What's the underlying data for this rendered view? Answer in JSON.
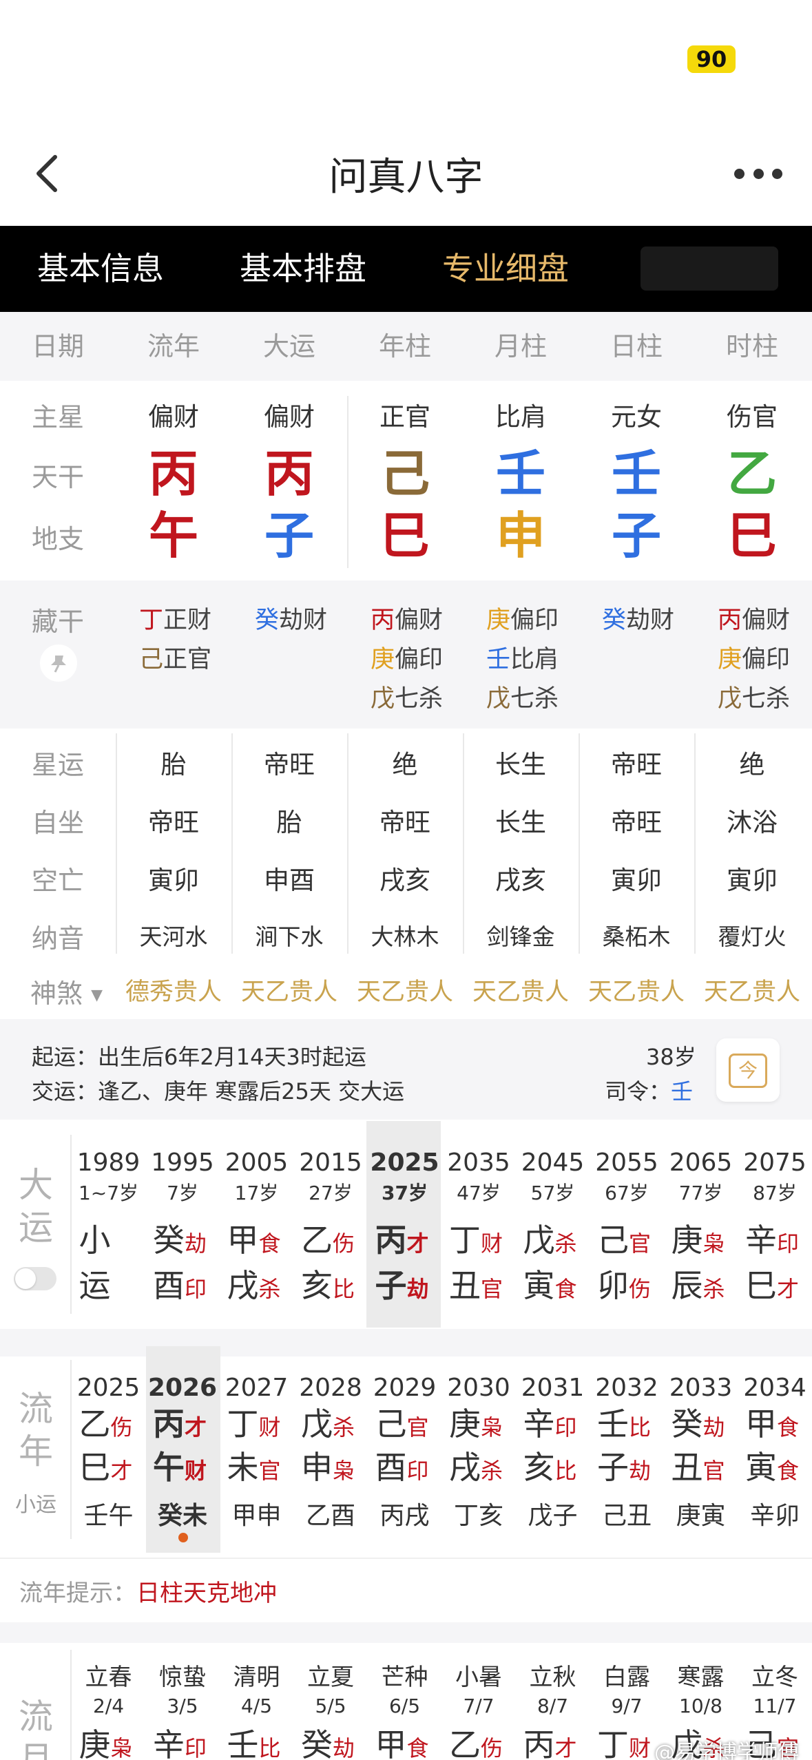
{
  "status": {
    "battery": "90"
  },
  "header": {
    "title": "问真八字"
  },
  "tabs": [
    "基本信息",
    "基本排盘",
    "专业细盘"
  ],
  "columns": [
    "日期",
    "流年",
    "大运",
    "年柱",
    "月柱",
    "日柱",
    "时柱"
  ],
  "zhuxing": {
    "label": "主星",
    "values": [
      "偏财",
      "偏财",
      "正官",
      "比肩",
      "元女",
      "伤官"
    ]
  },
  "tiangan": {
    "label": "天干",
    "values": [
      "丙",
      "丙",
      "己",
      "壬",
      "壬",
      "乙"
    ],
    "colors": [
      "#c0161e",
      "#c0161e",
      "#8a6a38",
      "#2f6fe0",
      "#2f6fe0",
      "#43a841"
    ]
  },
  "dizhi": {
    "label": "地支",
    "values": [
      "午",
      "子",
      "巳",
      "申",
      "子",
      "巳"
    ],
    "colors": [
      "#c0161e",
      "#2f6fe0",
      "#c0161e",
      "#e0a020",
      "#2f6fe0",
      "#c0161e"
    ]
  },
  "canggan": {
    "label": "藏干",
    "columns": [
      [
        {
          "g": "丁",
          "s": "正财",
          "c": "#c0161e"
        },
        {
          "g": "己",
          "s": "正官",
          "c": "#8a6a38"
        }
      ],
      [
        {
          "g": "癸",
          "s": "劫财",
          "c": "#2f6fe0"
        }
      ],
      [
        {
          "g": "丙",
          "s": "偏财",
          "c": "#c0161e"
        },
        {
          "g": "庚",
          "s": "偏印",
          "c": "#e0a020"
        },
        {
          "g": "戊",
          "s": "七杀",
          "c": "#8a6a38"
        }
      ],
      [
        {
          "g": "庚",
          "s": "偏印",
          "c": "#e0a020"
        },
        {
          "g": "壬",
          "s": "比肩",
          "c": "#2f6fe0"
        },
        {
          "g": "戊",
          "s": "七杀",
          "c": "#8a6a38"
        }
      ],
      [
        {
          "g": "癸",
          "s": "劫财",
          "c": "#2f6fe0"
        }
      ],
      [
        {
          "g": "丙",
          "s": "偏财",
          "c": "#c0161e"
        },
        {
          "g": "庚",
          "s": "偏印",
          "c": "#e0a020"
        },
        {
          "g": "戊",
          "s": "七杀",
          "c": "#8a6a38"
        }
      ]
    ]
  },
  "xingyun": {
    "label": "星运",
    "values": [
      "胎",
      "帝旺",
      "绝",
      "长生",
      "帝旺",
      "绝"
    ]
  },
  "zizuo": {
    "label": "自坐",
    "values": [
      "帝旺",
      "胎",
      "帝旺",
      "长生",
      "帝旺",
      "沐浴"
    ]
  },
  "kongwang": {
    "label": "空亡",
    "values": [
      "寅卯",
      "申酉",
      "戌亥",
      "戌亥",
      "寅卯",
      "寅卯"
    ]
  },
  "nayin": {
    "label": "纳音",
    "values": [
      "天河水",
      "涧下水",
      "大林木",
      "剑锋金",
      "桑柘木",
      "覆灯火"
    ]
  },
  "shensha": {
    "label": "神煞",
    "values": [
      "德秀贵人",
      "天乙贵人",
      "天乙贵人",
      "天乙贵人",
      "天乙贵人",
      "天乙贵人"
    ]
  },
  "qiyun": {
    "line1_label": "起运：",
    "line1": "出生后6年2月14天3时起运",
    "line2_label": "交运：",
    "line2": "逢乙、庚年 寒露后25天 交大运",
    "age": "38岁",
    "siling_label": "司令：",
    "siling": "壬",
    "icon_char": "今"
  },
  "dayun": {
    "label": [
      "大",
      "运"
    ],
    "items": [
      {
        "year": "1989",
        "age": "1~7岁",
        "g": "小",
        "gt": "",
        "gc": "",
        "z": "运",
        "zt": "",
        "zc": ""
      },
      {
        "year": "1995",
        "age": "7岁",
        "g": "癸",
        "gt": "劫",
        "gc": "#c0161e",
        "z": "酉",
        "zt": "印",
        "zc": "#c0161e"
      },
      {
        "year": "2005",
        "age": "17岁",
        "g": "甲",
        "gt": "食",
        "gc": "#c0161e",
        "z": "戌",
        "zt": "杀",
        "zc": "#c0161e"
      },
      {
        "year": "2015",
        "age": "27岁",
        "g": "乙",
        "gt": "伤",
        "gc": "#c0161e",
        "z": "亥",
        "zt": "比",
        "zc": "#c0161e"
      },
      {
        "year": "2025",
        "age": "37岁",
        "g": "丙",
        "gt": "才",
        "gc": "#c0161e",
        "z": "子",
        "zt": "劫",
        "zc": "#c0161e"
      },
      {
        "year": "2035",
        "age": "47岁",
        "g": "丁",
        "gt": "财",
        "gc": "#c0161e",
        "z": "丑",
        "zt": "官",
        "zc": "#c0161e"
      },
      {
        "year": "2045",
        "age": "57岁",
        "g": "戊",
        "gt": "杀",
        "gc": "#c0161e",
        "z": "寅",
        "zt": "食",
        "zc": "#c0161e"
      },
      {
        "year": "2055",
        "age": "67岁",
        "g": "己",
        "gt": "官",
        "gc": "#c0161e",
        "z": "卯",
        "zt": "伤",
        "zc": "#c0161e"
      },
      {
        "year": "2065",
        "age": "77岁",
        "g": "庚",
        "gt": "枭",
        "gc": "#c0161e",
        "z": "辰",
        "zt": "杀",
        "zc": "#c0161e"
      },
      {
        "year": "2075",
        "age": "87岁",
        "g": "辛",
        "gt": "印",
        "gc": "#c0161e",
        "z": "巳",
        "zt": "才",
        "zc": "#c0161e"
      }
    ],
    "selected_index": 4
  },
  "liunian": {
    "label": [
      "流",
      "年"
    ],
    "sublabel": "小运",
    "items": [
      {
        "year": "2025",
        "g": "乙",
        "gt": "伤",
        "z": "巳",
        "zt": "才",
        "xy": "壬午"
      },
      {
        "year": "2026",
        "g": "丙",
        "gt": "才",
        "z": "午",
        "zt": "财",
        "xy": "癸未"
      },
      {
        "year": "2027",
        "g": "丁",
        "gt": "财",
        "z": "未",
        "zt": "官",
        "xy": "甲申"
      },
      {
        "year": "2028",
        "g": "戊",
        "gt": "杀",
        "z": "申",
        "zt": "枭",
        "xy": "乙酉"
      },
      {
        "year": "2029",
        "g": "己",
        "gt": "官",
        "z": "酉",
        "zt": "印",
        "xy": "丙戌"
      },
      {
        "year": "2030",
        "g": "庚",
        "gt": "枭",
        "z": "戌",
        "zt": "杀",
        "xy": "丁亥"
      },
      {
        "year": "2031",
        "g": "辛",
        "gt": "印",
        "z": "亥",
        "zt": "比",
        "xy": "戊子"
      },
      {
        "year": "2032",
        "g": "壬",
        "gt": "比",
        "z": "子",
        "zt": "劫",
        "xy": "己丑"
      },
      {
        "year": "2033",
        "g": "癸",
        "gt": "劫",
        "z": "丑",
        "zt": "官",
        "xy": "庚寅"
      },
      {
        "year": "2034",
        "g": "甲",
        "gt": "食",
        "z": "寅",
        "zt": "食",
        "xy": "辛卯"
      }
    ],
    "selected_index": 1
  },
  "tishi": {
    "label": "流年提示：",
    "value": "日柱天克地冲"
  },
  "liuyue": {
    "label": [
      "流",
      "月"
    ],
    "items": [
      {
        "jq": "立春",
        "date": "2/4",
        "g": "庚",
        "gt": "枭"
      },
      {
        "jq": "惊蛰",
        "date": "3/5",
        "g": "辛",
        "gt": "印"
      },
      {
        "jq": "清明",
        "date": "4/5",
        "g": "壬",
        "gt": "比"
      },
      {
        "jq": "立夏",
        "date": "5/5",
        "g": "癸",
        "gt": "劫"
      },
      {
        "jq": "芒种",
        "date": "6/5",
        "g": "甲",
        "gt": "食"
      },
      {
        "jq": "小暑",
        "date": "7/7",
        "g": "乙",
        "gt": "伤"
      },
      {
        "jq": "立秋",
        "date": "8/7",
        "g": "丙",
        "gt": "才"
      },
      {
        "jq": "白露",
        "date": "9/7",
        "g": "丁",
        "gt": "财"
      },
      {
        "jq": "寒露",
        "date": "10/8",
        "g": "戊",
        "gt": "杀"
      },
      {
        "jq": "立冬",
        "date": "11/7",
        "g": "己",
        "gt": "官"
      }
    ]
  },
  "watermark": "@易学博学师傅"
}
